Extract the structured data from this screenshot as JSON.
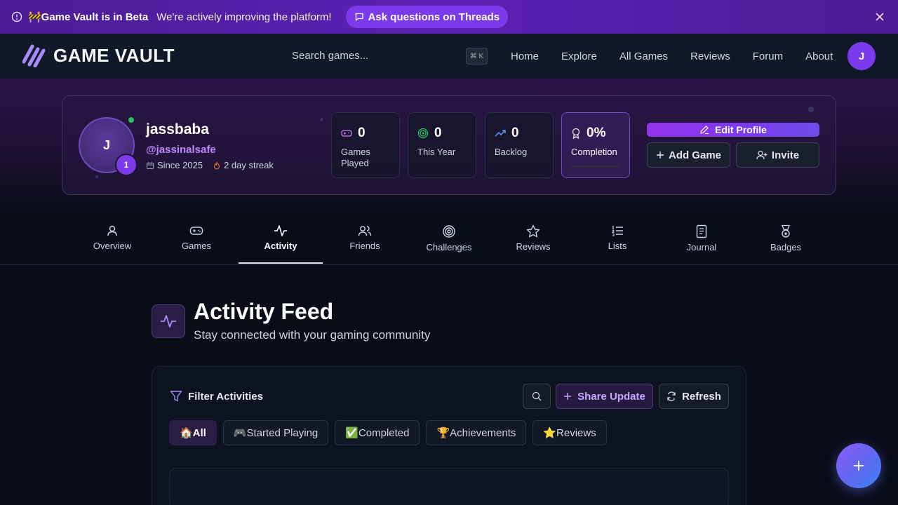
{
  "banner": {
    "title": "🚧Game Vault is in Beta",
    "message": "We're actively improving the platform!",
    "threads_label": "Ask questions on Threads"
  },
  "nav": {
    "logo_text": "GAME VAULT",
    "search_placeholder": "Search games...",
    "shortcut": "⌘ K",
    "links": [
      "Home",
      "Explore",
      "All Games",
      "Reviews",
      "Forum",
      "About"
    ],
    "avatar_initial": "J"
  },
  "profile": {
    "avatar_initial": "J",
    "level": "1",
    "username": "jassbaba",
    "handle": "@jassinalsafe",
    "since": "Since 2025",
    "streak": "2 day streak",
    "stats": [
      {
        "value": "0",
        "label": "Games Played",
        "icon": "gamepad-icon"
      },
      {
        "value": "0",
        "label": "This Year",
        "icon": "target-icon"
      },
      {
        "value": "0",
        "label": "Backlog",
        "icon": "trending-up-icon"
      },
      {
        "value": "0%",
        "label": "Completion",
        "icon": "award-icon"
      }
    ],
    "completion_progress": 0,
    "edit_label": "Edit Profile",
    "add_game_label": "Add Game",
    "invite_label": "Invite"
  },
  "tabs": [
    "Overview",
    "Games",
    "Activity",
    "Friends",
    "Challenges",
    "Reviews",
    "Lists",
    "Journal",
    "Badges"
  ],
  "active_tab": "Activity",
  "feed": {
    "title": "Activity Feed",
    "subtitle": "Stay connected with your gaming community",
    "filter_label": "Filter Activities",
    "share_label": "Share Update",
    "refresh_label": "Refresh",
    "chips": [
      "🏠All",
      "🎮Started Playing",
      "✅Completed",
      "🏆Achievements",
      "⭐Reviews"
    ]
  },
  "colors": {
    "accent": "#7c3aed",
    "banner_bg": "#5b21b6",
    "online": "#22c55e",
    "background": "#090d18"
  }
}
